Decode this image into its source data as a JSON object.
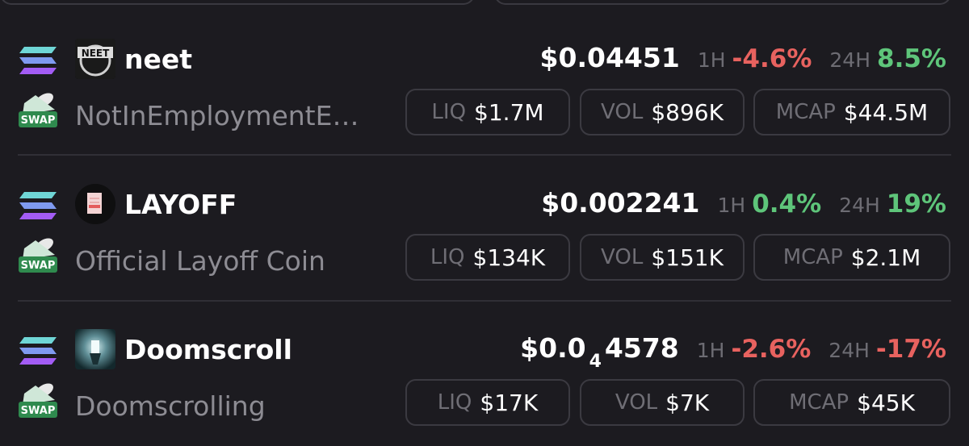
{
  "rows": [
    {
      "symbol": "neet",
      "name": "NotInEmploymentE…",
      "price": "$0.04451",
      "h1_label": "1H",
      "h1_change": "-4.6%",
      "h24_label": "24H",
      "h24_change": "8.5%",
      "liq_label": "LIQ",
      "liq": "$1.7M",
      "vol_label": "VOL",
      "vol": "$896K",
      "mcap_label": "MCAP",
      "mcap": "$44.5M"
    },
    {
      "symbol": "LAYOFF",
      "name": "Official Layoff Coin",
      "price": "$0.002241",
      "h1_label": "1H",
      "h1_change": "0.4%",
      "h24_label": "24H",
      "h24_change": "19%",
      "liq_label": "LIQ",
      "liq": "$134K",
      "vol_label": "VOL",
      "vol": "$151K",
      "mcap_label": "MCAP",
      "mcap": "$2.1M"
    },
    {
      "symbol": "Doomscroll",
      "name": "Doomscrolling",
      "price_prefix": "$0.0",
      "price_zeros": "4",
      "price_digits": "4578",
      "h1_label": "1H",
      "h1_change": "-2.6%",
      "h24_label": "24H",
      "h24_change": "-17%",
      "liq_label": "LIQ",
      "liq": "$17K",
      "vol_label": "VOL",
      "vol": "$7K",
      "mcap_label": "MCAP",
      "mcap": "$45K"
    }
  ],
  "icons": {
    "chain": "solana-icon",
    "dex": "swap-icon",
    "swap_text": "SWAP"
  },
  "colors": {
    "background": "#1c1b20",
    "negative": "#e8625f",
    "positive": "#5ec57a",
    "muted": "#8d8c93"
  }
}
